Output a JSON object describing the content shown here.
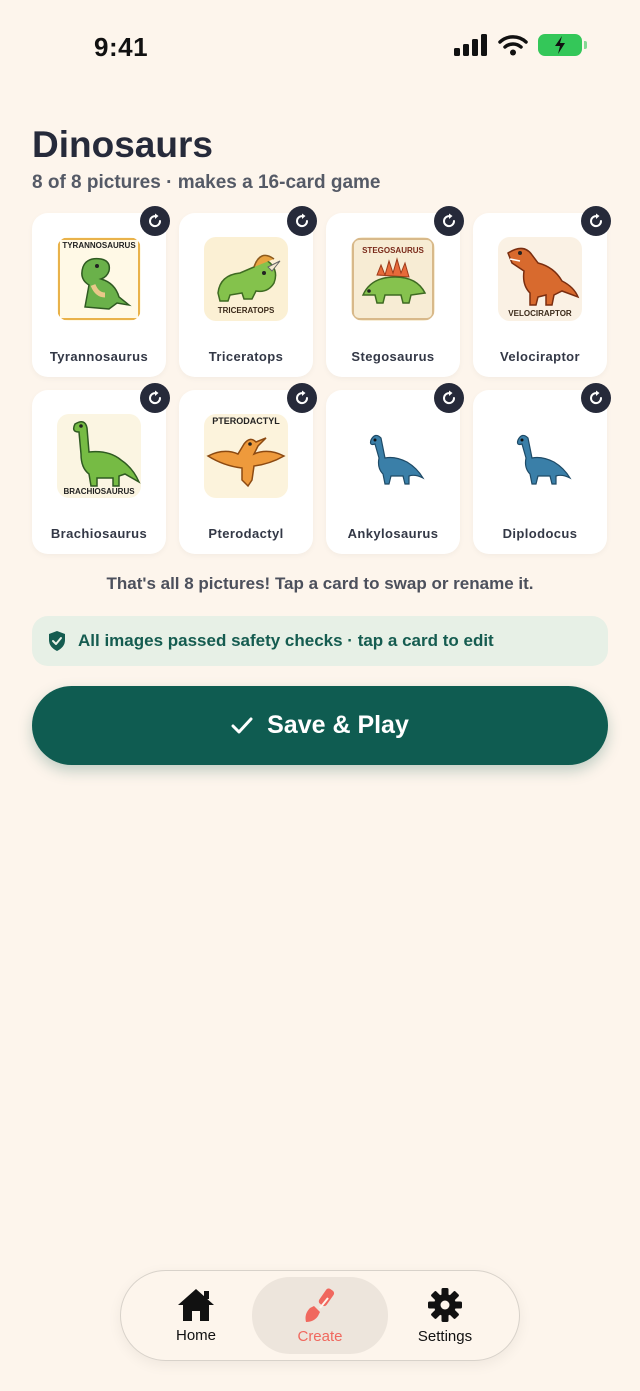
{
  "status_bar": {
    "time": "9:41"
  },
  "header": {
    "title": "Dinosaurs",
    "subtitle": "8 of 8 pictures · makes a 16-card game"
  },
  "cards": [
    {
      "label": "Tyrannosaurus",
      "image_caption": "TYRANNOSAURUS",
      "icon": "t-rex-icon"
    },
    {
      "label": "Triceratops",
      "image_caption": "TRICERATOPS",
      "icon": "triceratops-icon"
    },
    {
      "label": "Stegosaurus",
      "image_caption": "STEGOSAURUS",
      "icon": "stegosaurus-icon"
    },
    {
      "label": "Velociraptor",
      "image_caption": "VELOCIRAPTOR",
      "icon": "velociraptor-icon"
    },
    {
      "label": "Brachiosaurus",
      "image_caption": "BRACHIOSAURUS",
      "icon": "brachiosaurus-icon"
    },
    {
      "label": "Pterodactyl",
      "image_caption": "PTERODACTYL",
      "icon": "pterodactyl-icon"
    },
    {
      "label": "Ankylosaurus",
      "image_caption": "",
      "icon": "sauropod-emoji-icon"
    },
    {
      "label": "Diplodocus",
      "image_caption": "",
      "icon": "sauropod-emoji-icon"
    }
  ],
  "helper_text": "That's all 8 pictures! Tap a card to swap or rename it.",
  "safety_banner": {
    "text": "All images passed safety checks · tap a card to edit"
  },
  "save_button": {
    "label": "Save & Play"
  },
  "tab_bar": {
    "tabs": [
      {
        "label": "Home",
        "icon": "home-icon",
        "active": false
      },
      {
        "label": "Create",
        "icon": "paintbrush-icon",
        "active": true
      },
      {
        "label": "Settings",
        "icon": "gear-icon",
        "active": false
      }
    ]
  },
  "colors": {
    "background": "#fdf5ec",
    "accent": "#0f5c51",
    "active_tab": "#f0685e",
    "banner": "#e7f0e6"
  }
}
